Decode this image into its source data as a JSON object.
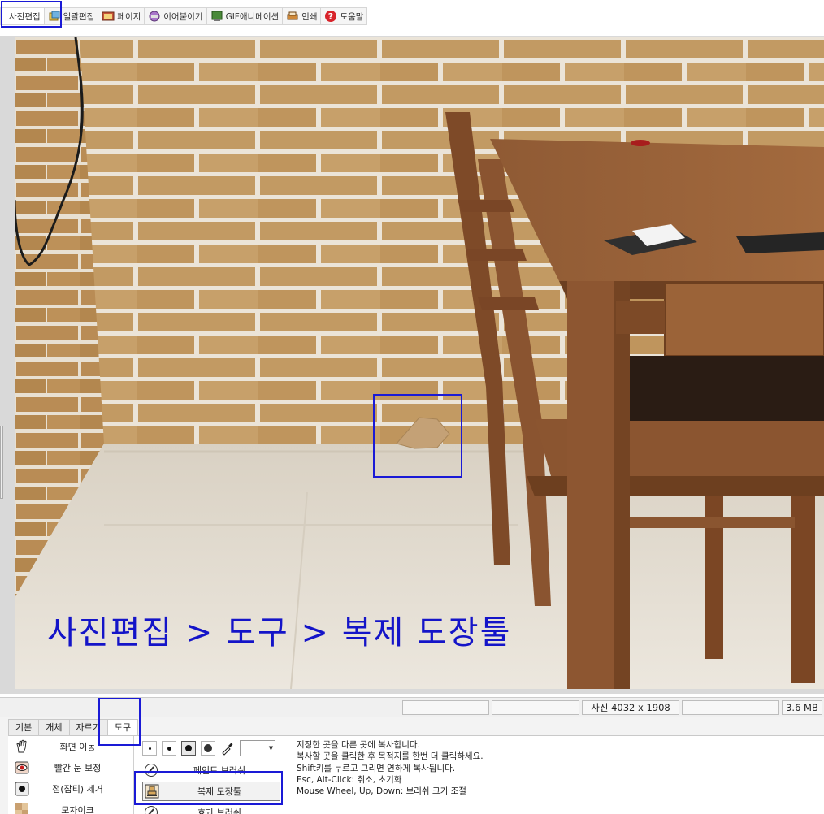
{
  "top_tabs": [
    {
      "label": "사진편집",
      "icon": "photo-edit-icon",
      "active": true
    },
    {
      "label": "일괄편집",
      "icon": "batch-edit-icon",
      "active": false
    },
    {
      "label": "페이지",
      "icon": "page-icon",
      "active": false
    },
    {
      "label": "이어붙이기",
      "icon": "merge-icon",
      "active": false
    },
    {
      "label": "GIF애니메이션",
      "icon": "gif-animation-icon",
      "active": false
    },
    {
      "label": "인쇄",
      "icon": "print-icon",
      "active": false
    },
    {
      "label": "도움말",
      "icon": "help-icon",
      "active": false
    }
  ],
  "photo": {
    "caption": "사진편집 > 도구 > 복제 도장툴"
  },
  "status": {
    "dimensions": "사진 4032 x 1908",
    "file_size": "3.6 MB"
  },
  "bottom_tabs": [
    {
      "label": "기본",
      "active": false
    },
    {
      "label": "개체",
      "active": false
    },
    {
      "label": "자르기",
      "active": false
    },
    {
      "label": "도구",
      "active": true
    }
  ],
  "tool_list": [
    {
      "label": "화면 이동",
      "icon": "hand-icon"
    },
    {
      "label": "빨간 눈 보정",
      "icon": "red-eye-icon"
    },
    {
      "label": "점(잡티) 제거",
      "icon": "spot-remove-icon"
    },
    {
      "label": "모자이크",
      "icon": "mosaic-icon"
    }
  ],
  "brush_sizes": [
    "small",
    "medium",
    "large",
    "xlarge"
  ],
  "selected_brush_size": "large",
  "tool_buttons": [
    {
      "label": "페인트 브러쉬",
      "icon": "paint-brush-icon",
      "selected": false
    },
    {
      "label": "복제 도장툴",
      "icon": "clone-stamp-icon",
      "selected": true
    },
    {
      "label": "효과 브러쉬",
      "icon": "effect-brush-icon",
      "selected": false
    }
  ],
  "help_lines": [
    "지정한 곳을 다른 곳에 복사합니다.",
    "복사할 곳을 클릭한 후 목적지를 한번 더 클릭하세요.",
    "Shift키를 누르고 그리면 연하게 복사됩니다.",
    "Esc, Alt-Click: 취소, 초기화",
    "Mouse Wheel, Up, Down: 브러쉬 크기 조절"
  ],
  "colors": {
    "highlight": "#1a1ad6",
    "caption": "#1414c8",
    "brick": "#c39a62",
    "mortar": "#ece6dc",
    "wood": "#8a5330",
    "floor": "#e4ddd2"
  }
}
